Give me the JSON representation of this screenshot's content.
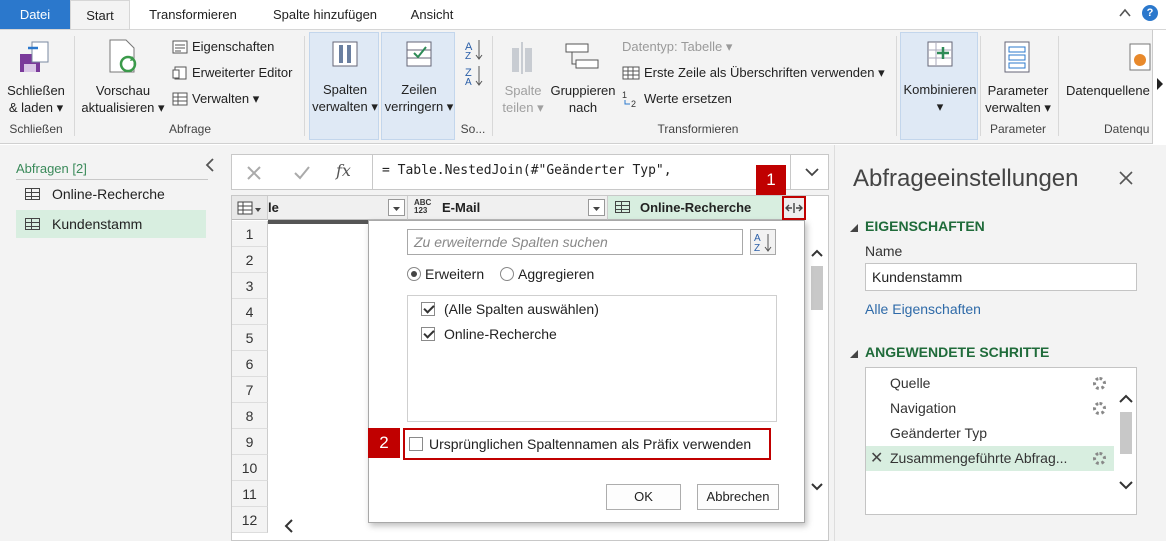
{
  "tabs": [
    "Datei",
    "Start",
    "Transformieren",
    "Spalte hinzufügen",
    "Ansicht"
  ],
  "ribbon": {
    "close_load": {
      "line1": "Schließen",
      "line2": "& laden"
    },
    "group_close": "Schließen",
    "preview": {
      "line1": "Vorschau",
      "line2": "aktualisieren"
    },
    "properties": "Eigenschaften",
    "advanced_editor": "Erweiterter Editor",
    "manage": "Verwalten",
    "group_query": "Abfrage",
    "columns": {
      "line1": "Spalten",
      "line2": "verwalten"
    },
    "rows": {
      "line1": "Zeilen",
      "line2": "verringern"
    },
    "group_sort": "So...",
    "split": {
      "line1": "Spalte",
      "line2": "teilen"
    },
    "group_by": {
      "line1": "Gruppieren",
      "line2": "nach"
    },
    "datatype": "Datentyp: Tabelle",
    "first_row": "Erste Zeile als Überschriften verwenden",
    "replace": "Werte ersetzen",
    "group_transform": "Transformieren",
    "combine": "Kombinieren",
    "parameters": {
      "line1": "Parameter",
      "line2": "verwalten"
    },
    "group_params": "Parameter",
    "datasource": "Datenquellene",
    "group_datasource": "Datenqu"
  },
  "left": {
    "header": "Abfragen [2]",
    "items": [
      "Online-Recherche",
      "Kundenstamm"
    ]
  },
  "formula": "= Table.NestedJoin(#\"Geänderter Typ\",",
  "grid": {
    "partial_col": "le",
    "type_badge": "ABC\n123",
    "col_email": "E-Mail",
    "col_online": "Online-Recherche",
    "rows": [
      "1",
      "2",
      "3",
      "4",
      "5",
      "6",
      "7",
      "8",
      "9",
      "10",
      "11",
      "12"
    ]
  },
  "popup": {
    "search_placeholder": "Zu erweiternde Spalten suchen",
    "expand": "Erweitern",
    "aggregate": "Aggregieren",
    "select_all": "(Alle Spalten auswählen)",
    "col_item": "Online-Recherche",
    "prefix": "Ursprünglichen Spaltennamen als Präfix verwenden",
    "ok": "OK",
    "cancel": "Abbrechen"
  },
  "callouts": {
    "one": "1",
    "two": "2"
  },
  "right": {
    "title": "Abfrageeinstellungen",
    "props_header": "EIGENSCHAFTEN",
    "name_label": "Name",
    "name_value": "Kundenstamm",
    "all_props": "Alle Eigenschaften",
    "steps_header": "ANGEWENDETE SCHRITTE",
    "steps": [
      "Quelle",
      "Navigation",
      "Geänderter Typ",
      "Zusammengeführte Abfrag..."
    ]
  },
  "colors": {
    "accent": "#2b78cc",
    "selected": "#d8eee0",
    "callout": "#c00000",
    "section": "#1f6b3a"
  }
}
